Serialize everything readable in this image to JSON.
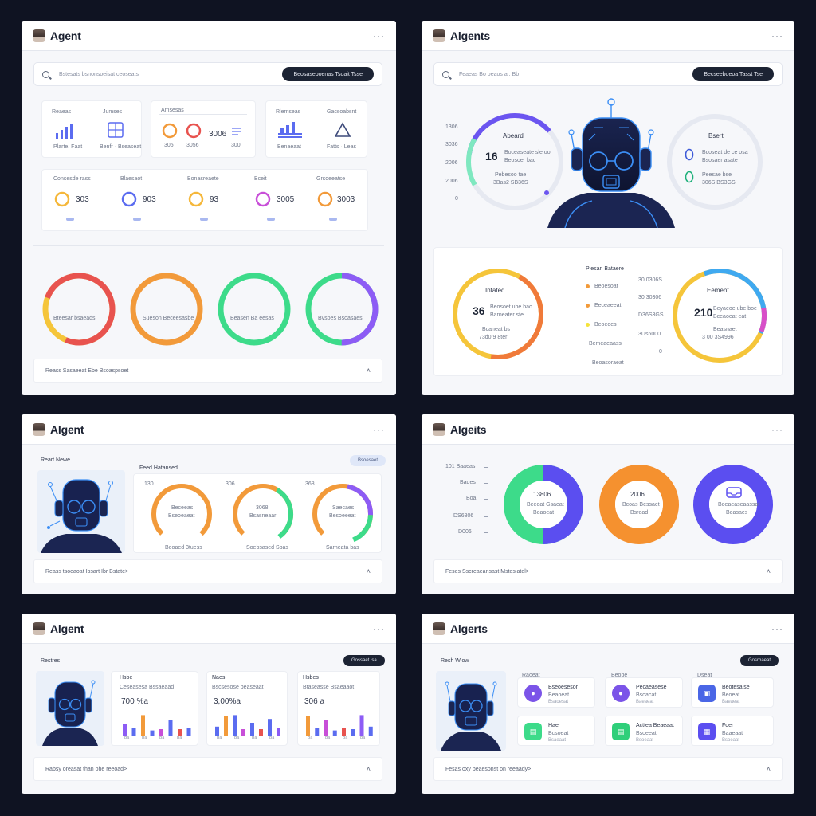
{
  "colors": {
    "red": "#e8534f",
    "orange": "#f29a3a",
    "green": "#3ddb8a",
    "purple": "#8d5cf5",
    "blue": "#5b6cf0",
    "navy": "#1c2333",
    "yellow": "#f5c53a",
    "teal": "#35cfc0"
  },
  "panel1": {
    "title": "Agent",
    "search_placeholder": "Bstesats bsnonsoeisat ceoseats",
    "search_button": "Beosaseboenas Tsoait Tsse",
    "cards": [
      {
        "label": "Reaeas",
        "sub": "Jumses",
        "caption1": "Plarte. Faat",
        "caption2": "Benfr · Bseaseat",
        "icon": "bar-chart-icon"
      },
      {
        "label": "Amsesas",
        "values": [
          "305",
          "3056",
          "300"
        ],
        "value": "3006",
        "icon": "progress-rings-icon"
      },
      {
        "label": "Rlemseas",
        "sub": "Gacsoabsnt",
        "caption1": "Benaeaat",
        "caption2": "Fatts · Leas",
        "icon": "triangle-icon"
      }
    ],
    "stats": [
      {
        "label": "Consesde rass",
        "value": "303"
      },
      {
        "label": "Blaesaot",
        "value": "903"
      },
      {
        "label": "Bonasreaete",
        "value": "93"
      },
      {
        "label": "Bceit",
        "value": "3005"
      },
      {
        "label": "Grsoeeatse",
        "value": "3003"
      }
    ],
    "rings": [
      {
        "label": "Bteesar  bsaeads"
      },
      {
        "label": "Sueson  Beceesasbe"
      },
      {
        "label": "Beasen  Ba eesas"
      },
      {
        "label": "Bvsoes  Bsoasaes"
      }
    ],
    "footer": "Reass  Sasaeeat Ebe Bsoaspsoet"
  },
  "panel2": {
    "title": "Algents",
    "search_placeholder": "Feaeas  Bo oeaos ar. Bb",
    "search_button": "Becseeboeoa  Tasst Tse",
    "axis": [
      "1306",
      "3036",
      "2006",
      "2006",
      "0"
    ],
    "ring_left": {
      "title": "Abeard",
      "value": "16",
      "line1": "Boceaseate sle oor",
      "line2": "Beosoer bac",
      "num1": "Pebesoo tae",
      "num2": "3Bas2    SB36S"
    },
    "ring_right": {
      "title": "Bsert",
      "line1": "Bcoseat de ce osa",
      "line2": "Bsosaer asate",
      "num1": "Peesae bse",
      "num2": "306S    BS3GS"
    },
    "legend_title": "Plesan Bataere",
    "legend": [
      "Beoesoat",
      "Eeceaeeat",
      "Beoeoes",
      "Bemeaeaass",
      "Beoasoraeat"
    ],
    "axis2": [
      "30 0306S",
      "30 30306",
      "D36S3GS",
      "3Us6000",
      "0"
    ],
    "ring_bl": {
      "title": "Infated",
      "value": "36",
      "line1": "Beosoet ube bac",
      "line2": "Barneater ste",
      "num1": "Bcaneat bs",
      "num2": "73d0    9 8ter"
    },
    "ring_br": {
      "title": "Eement",
      "value": "210",
      "line1": "Beyaeoe ube boe",
      "line2": "Bceaoeat eat",
      "num1": "Beasnaet",
      "num2": "3 00     3S4996"
    }
  },
  "panel3": {
    "title": "Algent",
    "left_title": "Reart Newe",
    "right_title": "Feed Hatansed",
    "pill": "Bsoesaet",
    "gauges": [
      {
        "top": "130",
        "label1": "Beceeas",
        "label2": "Bseoeaeat",
        "foot": "Beoaed 3tuess"
      },
      {
        "top": "306",
        "label1": "3068",
        "label2": "Bsasneaar",
        "foot": "Soebsased Sbas"
      },
      {
        "top": "368",
        "label1": "Saecaes",
        "label2": "Besoeeeat",
        "foot": "Sarneata bas"
      }
    ],
    "footer": "Reass  tsoeaoat Ibsart  Ibr Bstate>"
  },
  "panel4": {
    "title": "Algeits",
    "axis": [
      "101  Baaeas",
      "Bades",
      "Boa",
      "DS6806",
      "D006"
    ],
    "donuts": [
      {
        "value": "13806",
        "line1": "Beeoat Gsaeat",
        "line2": "Beaoeat"
      },
      {
        "value": "2006",
        "line1": "Bcoas Bessaet",
        "line2": "Bsread"
      },
      {
        "value": "",
        "line1": "Boeaeaseaassat",
        "line2": "Beasaes"
      }
    ],
    "footer": "Feses  Sscreaeansast  Msteslatel>"
  },
  "panel5": {
    "title": "Algent",
    "left_title": "Restres",
    "pill": "Gossaet lsa",
    "cards": [
      {
        "label": "Hsbe",
        "sub": "Ceseasesa  Bssaeaad",
        "value": "700 %a"
      },
      {
        "label": "Naes",
        "sub": "Bscsesose  beaseaat",
        "value": "3,00%a"
      },
      {
        "label": "Hsbes",
        "sub": "Btaseasse  Bsaeaaot",
        "value": "306 a"
      }
    ],
    "bars": [
      {
        "values": [
          0.45,
          0.3,
          0.8,
          0.2,
          0.25,
          0.6,
          0.25,
          0.3
        ]
      },
      {
        "values": [
          0.35,
          0.75,
          0.8,
          0.25,
          0.5,
          0.25,
          0.65,
          0.3
        ]
      },
      {
        "values": [
          0.75,
          0.3,
          0.6,
          0.2,
          0.3,
          0.25,
          0.8,
          0.35
        ]
      }
    ],
    "bar_axis": [
      "Ba",
      "Ba",
      "Ba",
      "Ba"
    ],
    "footer": "Rabsy oreasat  than ohe reeoad>"
  },
  "panel6": {
    "title": "Algerts",
    "left_title": "Resh Wiow",
    "pill": "Gosrbaeat",
    "col_heads": [
      "Raoeat",
      "Beobe",
      "Dseat"
    ],
    "items": [
      {
        "title": "Bseoesesor",
        "sub": "Beaoeat",
        "note": "Bsaoesat"
      },
      {
        "title": "Pecaeasese",
        "sub": "Bsoacat",
        "note": "Baeaeat"
      },
      {
        "title": "Beotesaise",
        "sub": "Beoeat",
        "note": "Baeaeat"
      },
      {
        "title": "Haer",
        "sub": "Bcsoeat",
        "note": "Bsaeaat"
      },
      {
        "title": "Acttea Beaeaat",
        "sub": "Bsoeeat",
        "note": "Bsoeaat"
      },
      {
        "title": "Foer",
        "sub": "Baaeaat",
        "note": "Bsoeaat"
      }
    ],
    "footer": "Fesas  oxy beaesonst  on reeaady>"
  }
}
